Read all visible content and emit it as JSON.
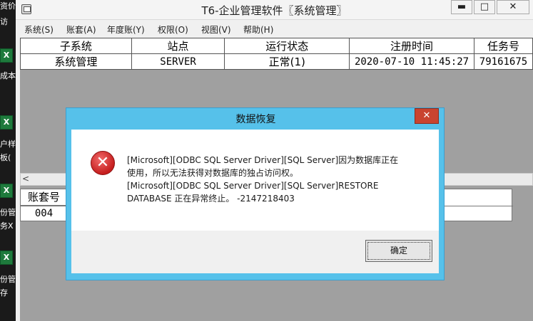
{
  "desktop": {
    "labels": [
      "资价",
      "访",
      "成本",
      "户样",
      "板(",
      "份管",
      "务X",
      "份管",
      "存"
    ]
  },
  "window": {
    "title": "T6-企业管理软件〖系统管理〗",
    "minimize": "▬",
    "maximize": "□",
    "close": "✕"
  },
  "menu": [
    "系统(S)",
    "账套(A)",
    "年度账(Y)",
    "权限(O)",
    "视图(V)",
    "帮助(H)"
  ],
  "grid": {
    "headers": [
      "子系统",
      "站点",
      "运行状态",
      "注册时间",
      "任务号"
    ],
    "rows": [
      [
        "系统管理",
        "SERVER",
        "正常(1)",
        "2020-07-10 11:45:27",
        "79161675"
      ]
    ]
  },
  "lower_grid": {
    "header": "账套号",
    "value": "004"
  },
  "scroll_arrow": "<",
  "dialog": {
    "title": "数据恢复",
    "close": "✕",
    "icon": "error-icon",
    "message_lines": [
      "[Microsoft][ODBC SQL Server Driver][SQL Server]因为数据库正在",
      "使用，所以无法获得对数据库的独占访问权。",
      "[Microsoft][ODBC SQL Server Driver][SQL Server]RESTORE",
      "DATABASE 正在异常终止。 -2147218403"
    ],
    "ok_label": "确定"
  }
}
